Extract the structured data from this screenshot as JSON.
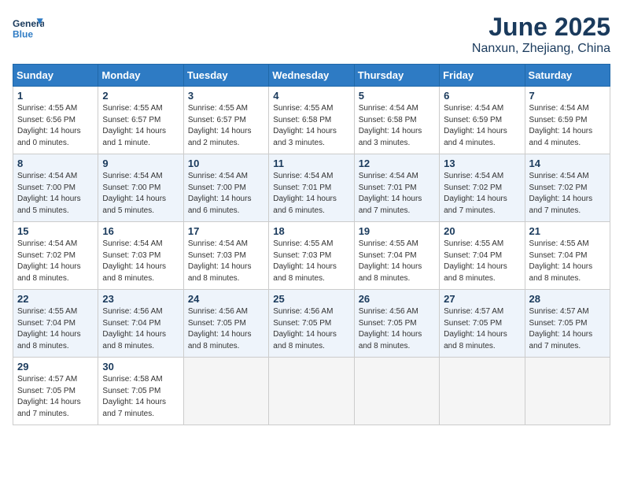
{
  "logo": {
    "line1": "General",
    "line2": "Blue"
  },
  "title": "June 2025",
  "location": "Nanxun, Zhejiang, China",
  "headers": [
    "Sunday",
    "Monday",
    "Tuesday",
    "Wednesday",
    "Thursday",
    "Friday",
    "Saturday"
  ],
  "weeks": [
    [
      {
        "day": "1",
        "info": "Sunrise: 4:55 AM\nSunset: 6:56 PM\nDaylight: 14 hours\nand 0 minutes."
      },
      {
        "day": "2",
        "info": "Sunrise: 4:55 AM\nSunset: 6:57 PM\nDaylight: 14 hours\nand 1 minute."
      },
      {
        "day": "3",
        "info": "Sunrise: 4:55 AM\nSunset: 6:57 PM\nDaylight: 14 hours\nand 2 minutes."
      },
      {
        "day": "4",
        "info": "Sunrise: 4:55 AM\nSunset: 6:58 PM\nDaylight: 14 hours\nand 3 minutes."
      },
      {
        "day": "5",
        "info": "Sunrise: 4:54 AM\nSunset: 6:58 PM\nDaylight: 14 hours\nand 3 minutes."
      },
      {
        "day": "6",
        "info": "Sunrise: 4:54 AM\nSunset: 6:59 PM\nDaylight: 14 hours\nand 4 minutes."
      },
      {
        "day": "7",
        "info": "Sunrise: 4:54 AM\nSunset: 6:59 PM\nDaylight: 14 hours\nand 4 minutes."
      }
    ],
    [
      {
        "day": "8",
        "info": "Sunrise: 4:54 AM\nSunset: 7:00 PM\nDaylight: 14 hours\nand 5 minutes."
      },
      {
        "day": "9",
        "info": "Sunrise: 4:54 AM\nSunset: 7:00 PM\nDaylight: 14 hours\nand 5 minutes."
      },
      {
        "day": "10",
        "info": "Sunrise: 4:54 AM\nSunset: 7:00 PM\nDaylight: 14 hours\nand 6 minutes."
      },
      {
        "day": "11",
        "info": "Sunrise: 4:54 AM\nSunset: 7:01 PM\nDaylight: 14 hours\nand 6 minutes."
      },
      {
        "day": "12",
        "info": "Sunrise: 4:54 AM\nSunset: 7:01 PM\nDaylight: 14 hours\nand 7 minutes."
      },
      {
        "day": "13",
        "info": "Sunrise: 4:54 AM\nSunset: 7:02 PM\nDaylight: 14 hours\nand 7 minutes."
      },
      {
        "day": "14",
        "info": "Sunrise: 4:54 AM\nSunset: 7:02 PM\nDaylight: 14 hours\nand 7 minutes."
      }
    ],
    [
      {
        "day": "15",
        "info": "Sunrise: 4:54 AM\nSunset: 7:02 PM\nDaylight: 14 hours\nand 8 minutes."
      },
      {
        "day": "16",
        "info": "Sunrise: 4:54 AM\nSunset: 7:03 PM\nDaylight: 14 hours\nand 8 minutes."
      },
      {
        "day": "17",
        "info": "Sunrise: 4:54 AM\nSunset: 7:03 PM\nDaylight: 14 hours\nand 8 minutes."
      },
      {
        "day": "18",
        "info": "Sunrise: 4:55 AM\nSunset: 7:03 PM\nDaylight: 14 hours\nand 8 minutes."
      },
      {
        "day": "19",
        "info": "Sunrise: 4:55 AM\nSunset: 7:04 PM\nDaylight: 14 hours\nand 8 minutes."
      },
      {
        "day": "20",
        "info": "Sunrise: 4:55 AM\nSunset: 7:04 PM\nDaylight: 14 hours\nand 8 minutes."
      },
      {
        "day": "21",
        "info": "Sunrise: 4:55 AM\nSunset: 7:04 PM\nDaylight: 14 hours\nand 8 minutes."
      }
    ],
    [
      {
        "day": "22",
        "info": "Sunrise: 4:55 AM\nSunset: 7:04 PM\nDaylight: 14 hours\nand 8 minutes."
      },
      {
        "day": "23",
        "info": "Sunrise: 4:56 AM\nSunset: 7:04 PM\nDaylight: 14 hours\nand 8 minutes."
      },
      {
        "day": "24",
        "info": "Sunrise: 4:56 AM\nSunset: 7:05 PM\nDaylight: 14 hours\nand 8 minutes."
      },
      {
        "day": "25",
        "info": "Sunrise: 4:56 AM\nSunset: 7:05 PM\nDaylight: 14 hours\nand 8 minutes."
      },
      {
        "day": "26",
        "info": "Sunrise: 4:56 AM\nSunset: 7:05 PM\nDaylight: 14 hours\nand 8 minutes."
      },
      {
        "day": "27",
        "info": "Sunrise: 4:57 AM\nSunset: 7:05 PM\nDaylight: 14 hours\nand 8 minutes."
      },
      {
        "day": "28",
        "info": "Sunrise: 4:57 AM\nSunset: 7:05 PM\nDaylight: 14 hours\nand 7 minutes."
      }
    ],
    [
      {
        "day": "29",
        "info": "Sunrise: 4:57 AM\nSunset: 7:05 PM\nDaylight: 14 hours\nand 7 minutes."
      },
      {
        "day": "30",
        "info": "Sunrise: 4:58 AM\nSunset: 7:05 PM\nDaylight: 14 hours\nand 7 minutes."
      },
      null,
      null,
      null,
      null,
      null
    ]
  ]
}
